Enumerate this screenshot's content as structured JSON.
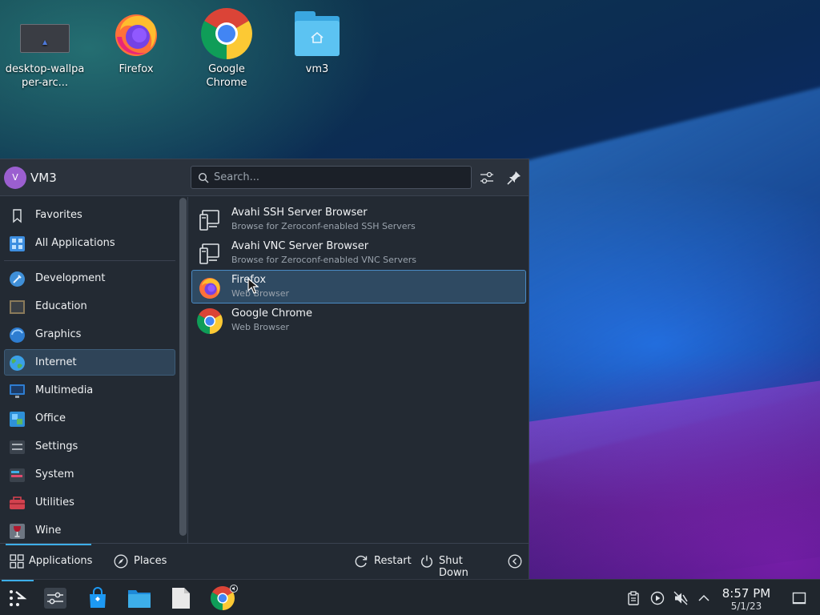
{
  "desktop": {
    "icons": [
      {
        "label": "desktop-wallpaper-arc...",
        "icon": "image-thumbnail-icon"
      },
      {
        "label": "Firefox",
        "icon": "firefox-icon"
      },
      {
        "label": "Google Chrome",
        "icon": "chrome-icon"
      },
      {
        "label": "vm3",
        "icon": "home-folder-icon"
      }
    ]
  },
  "launcher": {
    "user": {
      "initial": "V",
      "name": "VM3"
    },
    "search": {
      "placeholder": "Search..."
    },
    "categories": [
      {
        "label": "Favorites",
        "icon": "bookmark-icon"
      },
      {
        "label": "All Applications",
        "icon": "grid-icon"
      },
      {
        "label": "Development",
        "icon": "development-icon"
      },
      {
        "label": "Education",
        "icon": "education-icon"
      },
      {
        "label": "Graphics",
        "icon": "graphics-icon"
      },
      {
        "label": "Internet",
        "icon": "internet-globe-icon",
        "selected": true
      },
      {
        "label": "Multimedia",
        "icon": "multimedia-icon"
      },
      {
        "label": "Office",
        "icon": "office-icon"
      },
      {
        "label": "Settings",
        "icon": "settings-icon"
      },
      {
        "label": "System",
        "icon": "system-icon"
      },
      {
        "label": "Utilities",
        "icon": "utilities-icon"
      },
      {
        "label": "Wine",
        "icon": "wine-glass-icon"
      }
    ],
    "apps": [
      {
        "name": "Avahi SSH Server Browser",
        "description": "Browse for Zeroconf-enabled SSH Servers",
        "icon": "network-server-icon"
      },
      {
        "name": "Avahi VNC Server Browser",
        "description": "Browse for Zeroconf-enabled VNC Servers",
        "icon": "network-server-icon"
      },
      {
        "name": "Firefox",
        "description": "Web Browser",
        "icon": "firefox-icon",
        "hovered": true
      },
      {
        "name": "Google Chrome",
        "description": "Web Browser",
        "icon": "chrome-icon"
      }
    ],
    "footer": {
      "applications_label": "Applications",
      "places_label": "Places",
      "restart_label": "Restart",
      "shutdown_label": "Shut Down"
    }
  },
  "taskbar": {
    "clock_time": "8:57 PM",
    "clock_date": "5/1/23"
  },
  "colors": {
    "accent": "#3daee9",
    "panel_bg": "#232a33",
    "selected_bg": "#2f4458",
    "hover_bg": "#2f4a62"
  }
}
